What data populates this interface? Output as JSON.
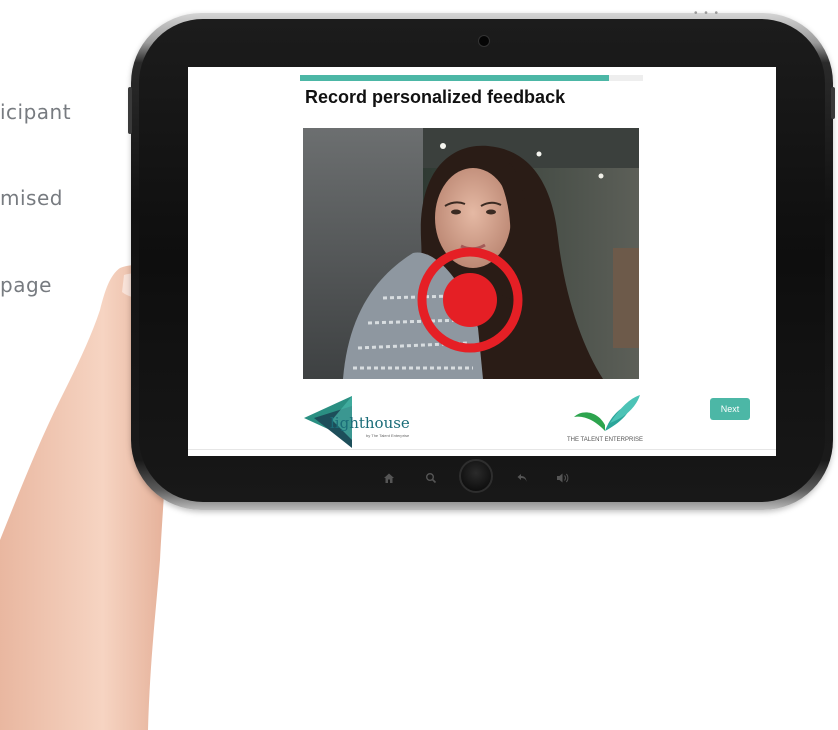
{
  "side_items": [
    "icipant",
    "mised",
    "page"
  ],
  "screen": {
    "title": "Record personalized feedback",
    "progress": 0.9,
    "next_label": "Next"
  },
  "logos": {
    "lighthouse_main": "lighthouse",
    "lighthouse_sub": "by The Talent Enterprise",
    "talent_enterprise": "THE TALENT ENTERPRISE"
  },
  "colors": {
    "accent": "#4cb7a6",
    "record": "#e51f25"
  },
  "icons": {
    "home": "home-icon",
    "search": "search-icon",
    "back": "back-arrow-icon",
    "volume": "volume-icon"
  }
}
